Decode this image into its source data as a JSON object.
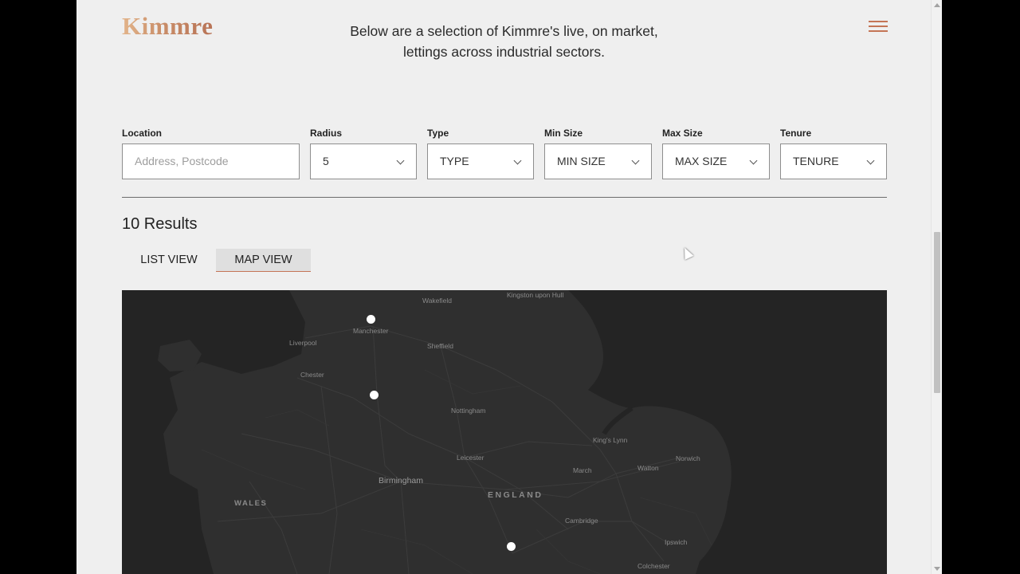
{
  "header": {
    "logo_text": "Kimmre",
    "intro_line1": "Below are a selection of Kimmre's live, on market,",
    "intro_line2": "lettings across industrial sectors."
  },
  "filters": {
    "location": {
      "label": "Location",
      "placeholder": "Address, Postcode"
    },
    "radius": {
      "label": "Radius",
      "value": "5"
    },
    "type": {
      "label": "Type",
      "value": "TYPE"
    },
    "min_size": {
      "label": "Min Size",
      "value": "MIN SIZE"
    },
    "max_size": {
      "label": "Max Size",
      "value": "MAX SIZE"
    },
    "tenure": {
      "label": "Tenure",
      "value": "TENURE"
    }
  },
  "results": {
    "count_text": "10 Results"
  },
  "views": {
    "list_label": "LIST VIEW",
    "map_label": "MAP VIEW",
    "active": "MAP VIEW"
  },
  "map": {
    "towns": [
      "Wakefield",
      "Kingston upon Hull",
      "Manchester",
      "Liverpool",
      "Sheffield",
      "Chester",
      "Nottingham",
      "King's Lynn",
      "Leicester",
      "Norwich",
      "Watton",
      "March",
      "Birmingham",
      "Cambridge",
      "Ipswich",
      "Colchester"
    ],
    "regions": [
      "WALES",
      "ENGLAND"
    ],
    "pins": 3
  },
  "colors": {
    "page_bg": "#efefef",
    "accent": "#c47556",
    "map_bg": "#242424",
    "land": "#2f2f2f"
  }
}
